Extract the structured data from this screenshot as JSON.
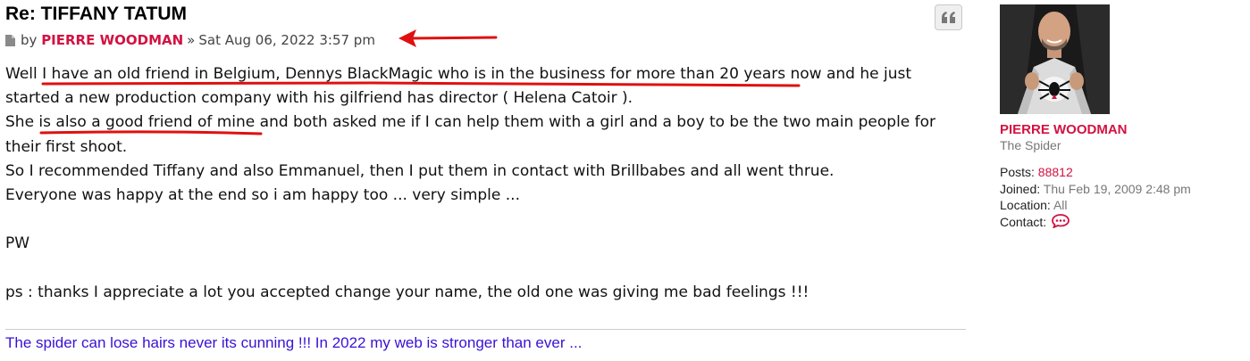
{
  "post": {
    "title": "Re: TIFFANY TATUM",
    "by_label": "by",
    "author": "PIERRE WOODMAN",
    "separator": "»",
    "date": "Sat Aug 06, 2022 3:57 pm",
    "quote_icon": "quote-icon",
    "doc_icon": "post-icon",
    "content": {
      "l1": "Well I have an old friend in Belgium, Dennys BlackMagic who is in the business for more than 20 years now and he just",
      "l2": "started a new production company with his gilfriend has director ( Helena Catoir ).",
      "l3": "She is also a good friend of mine and both asked me if I can help them with a girl and a boy to be the two main people for",
      "l4": "their first shoot.",
      "l5": "So I recommended Tiffany and also Emmanuel, then I put them in contact with Brillbabes and all went thrue.",
      "l6": "Everyone was happy at the end so i am happy too ... very simple ...",
      "l7": "PW",
      "l8": "ps : thanks I appreciate a lot you accepted change your name, the old one was giving me bad feelings !!!"
    },
    "signature": "The spider can lose hairs never its cunning !!! In 2022 my web is stronger than ever ..."
  },
  "profile": {
    "name": "PIERRE WOODMAN",
    "rank": "The Spider",
    "posts_label": "Posts:",
    "posts": "88812",
    "joined_label": "Joined:",
    "joined": "Thu Feb 19, 2009 2:48 pm",
    "location_label": "Location:",
    "location": "All",
    "contact_label": "Contact:",
    "contact_icon": "speech-bubble-icon"
  },
  "colors": {
    "author_red": "#d31141",
    "signature_purple": "#3a11d4",
    "annotation_red": "#e01010"
  }
}
